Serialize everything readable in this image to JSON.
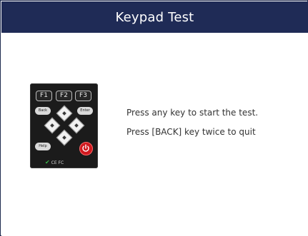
{
  "header": {
    "title": "Keypad Test"
  },
  "keypad": {
    "f_keys": [
      "F1",
      "F2",
      "F3"
    ],
    "back_label": "Back",
    "enter_label": "Enter",
    "help_label": "Help",
    "marks": "CE FC"
  },
  "message": {
    "line1": "Press any key to start the test.",
    "line2": "Press [BACK] key twice to quit"
  },
  "colors": {
    "titlebar": "#1f2b56",
    "power": "#d0191f",
    "check": "#39b54a"
  },
  "icons": [
    "power-icon",
    "check-icon",
    "arrow-up-icon",
    "arrow-down-icon",
    "arrow-left-icon",
    "arrow-right-icon"
  ]
}
